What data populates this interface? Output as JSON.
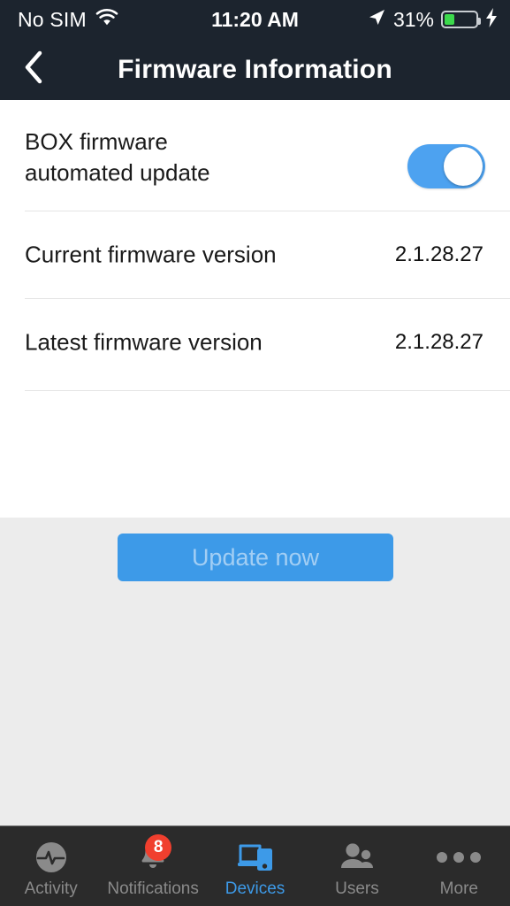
{
  "status_bar": {
    "carrier": "No SIM",
    "wifi_icon": "wifi-icon",
    "time": "11:20 AM",
    "location_icon": "location-arrow-icon",
    "battery_percent": "31%",
    "battery_level": 31,
    "charging_icon": "lightning-bolt-icon"
  },
  "nav": {
    "back_icon": "chevron-left-icon",
    "title": "Firmware Information"
  },
  "settings": {
    "auto_update": {
      "label_line1": "BOX firmware",
      "label_line2": "automated update",
      "toggle_state": "on",
      "toggle_color": "#4da2f0"
    },
    "current_version": {
      "label": "Current firmware version",
      "value": "2.1.28.27"
    },
    "latest_version": {
      "label": "Latest firmware version",
      "value": "2.1.28.27"
    },
    "update_button": {
      "label": "Update now",
      "color": "#3d9ae8",
      "state": "disabled"
    }
  },
  "tabbar": {
    "active_color": "#3d9ae8",
    "inactive_color": "#8a8a8a",
    "items": [
      {
        "label": "Activity",
        "icon": "activity-pulse-icon",
        "active": false
      },
      {
        "label": "Notifications",
        "icon": "bell-icon",
        "active": false,
        "badge": "8",
        "badge_color": "#f03f2e"
      },
      {
        "label": "Devices",
        "icon": "devices-laptop-phone-icon",
        "active": true
      },
      {
        "label": "Users",
        "icon": "users-icon",
        "active": false
      },
      {
        "label": "More",
        "icon": "ellipsis-icon",
        "active": false
      }
    ]
  }
}
